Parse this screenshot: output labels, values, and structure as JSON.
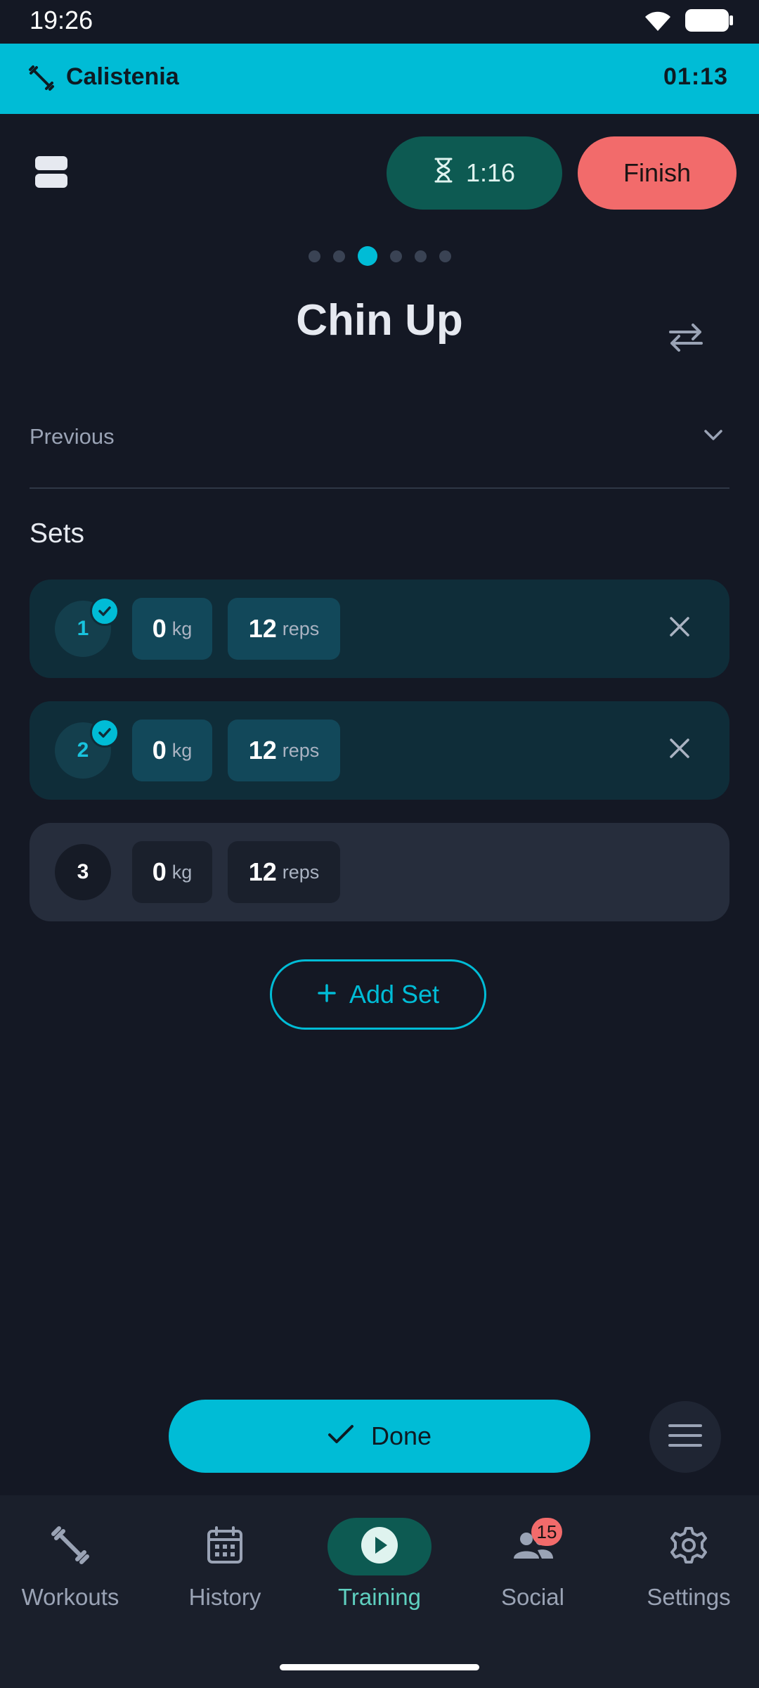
{
  "status": {
    "time": "19:26",
    "icons": [
      "wifi-icon",
      "battery-icon"
    ]
  },
  "workout": {
    "name": "Calistenia",
    "elapsed": "01:13",
    "icon": "dumbbell-icon"
  },
  "toolbar": {
    "rest_timer": "1:16",
    "finish_label": "Finish"
  },
  "pager": {
    "count": 6,
    "active_index": 2
  },
  "exercise": {
    "title": "Chin Up"
  },
  "previous": {
    "label": "Previous"
  },
  "sets": {
    "label": "Sets",
    "items": [
      {
        "number": "1",
        "weight": "0",
        "weight_unit": "kg",
        "reps": "12",
        "reps_unit": "reps",
        "completed": true
      },
      {
        "number": "2",
        "weight": "0",
        "weight_unit": "kg",
        "reps": "12",
        "reps_unit": "reps",
        "completed": true
      },
      {
        "number": "3",
        "weight": "0",
        "weight_unit": "kg",
        "reps": "12",
        "reps_unit": "reps",
        "completed": false
      }
    ]
  },
  "add_set": {
    "label": "Add Set"
  },
  "done": {
    "label": "Done"
  },
  "nav": {
    "items": [
      {
        "label": "Workouts",
        "icon": "dumbbell-icon",
        "active": false
      },
      {
        "label": "History",
        "icon": "calendar-icon",
        "active": false
      },
      {
        "label": "Training",
        "icon": "play-icon",
        "active": true
      },
      {
        "label": "Social",
        "icon": "people-icon",
        "active": false,
        "badge": "15"
      },
      {
        "label": "Settings",
        "icon": "gear-icon",
        "active": false
      }
    ]
  },
  "colors": {
    "accent": "#00bcd6",
    "finish": "#f26b6b",
    "timer_bg": "#0d5a52",
    "background": "#141824"
  }
}
